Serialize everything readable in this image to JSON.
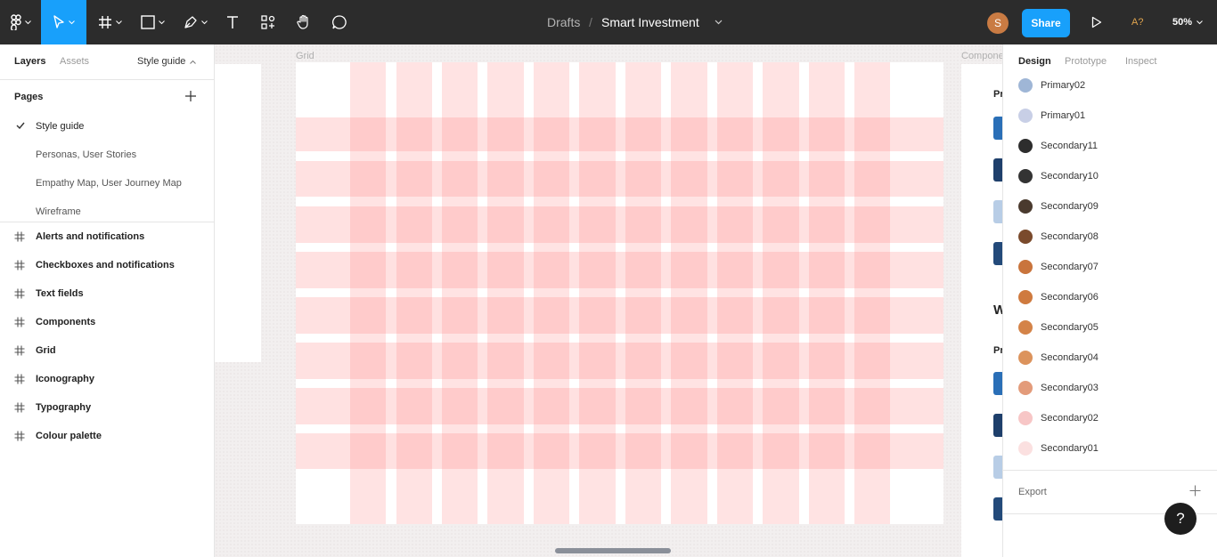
{
  "toolbar": {
    "breadcrumb_root": "Drafts",
    "breadcrumb_sep": "/",
    "file_title": "Smart Investment",
    "avatar_initial": "S",
    "share_label": "Share",
    "a11y_label": "A?",
    "zoom_label": "50%",
    "accent_color": "#18a0fb",
    "tools": [
      "figma-menu-icon",
      "move-icon",
      "frame-icon",
      "shape-icon",
      "pen-icon",
      "text-icon",
      "resources-icon",
      "hand-icon",
      "comment-icon",
      "present-icon"
    ]
  },
  "left_panel": {
    "tabs": {
      "layers": "Layers",
      "assets": "Assets",
      "page": "Style guide"
    },
    "pages_header": "Pages",
    "pages": [
      "Style guide",
      "Personas, User Stories",
      "Empathy Map, User Journey Map",
      "Wireframe"
    ],
    "layers": [
      "Alerts and notifications",
      "Checkboxes and notifications",
      "Text fields",
      "Components",
      "Grid",
      "Iconography",
      "Typography",
      "Colour palette"
    ]
  },
  "canvas": {
    "frame_labels": {
      "grid": "Grid",
      "components": "Compone"
    },
    "right_frame_text": {
      "heading_1": "Pr",
      "big": "W",
      "heading_2": "Pr"
    },
    "grid_color": "#ff8080"
  },
  "right_panel": {
    "tabs": {
      "design": "Design",
      "prototype": "Prototype",
      "inspect": "Inspect"
    },
    "colors": [
      {
        "name": "Primary02",
        "color": "#9fb6d6"
      },
      {
        "name": "Primary01",
        "color": "#c8cfe6"
      },
      {
        "name": "Secondary11",
        "color": "#2d2d2d"
      },
      {
        "name": "Secondary10",
        "color": "#333333"
      },
      {
        "name": "Secondary09",
        "color": "#4a3a2e"
      },
      {
        "name": "Secondary08",
        "color": "#7a4a2c"
      },
      {
        "name": "Secondary07",
        "color": "#c9743c"
      },
      {
        "name": "Secondary06",
        "color": "#cf7a3e"
      },
      {
        "name": "Secondary05",
        "color": "#d48348"
      },
      {
        "name": "Secondary04",
        "color": "#dc935c"
      },
      {
        "name": "Secondary03",
        "color": "#e39b7a"
      },
      {
        "name": "Secondary02",
        "color": "#f7c6c6"
      },
      {
        "name": "Secondary01",
        "color": "#fbe0e0"
      }
    ],
    "export_label": "Export",
    "help_label": "?"
  }
}
